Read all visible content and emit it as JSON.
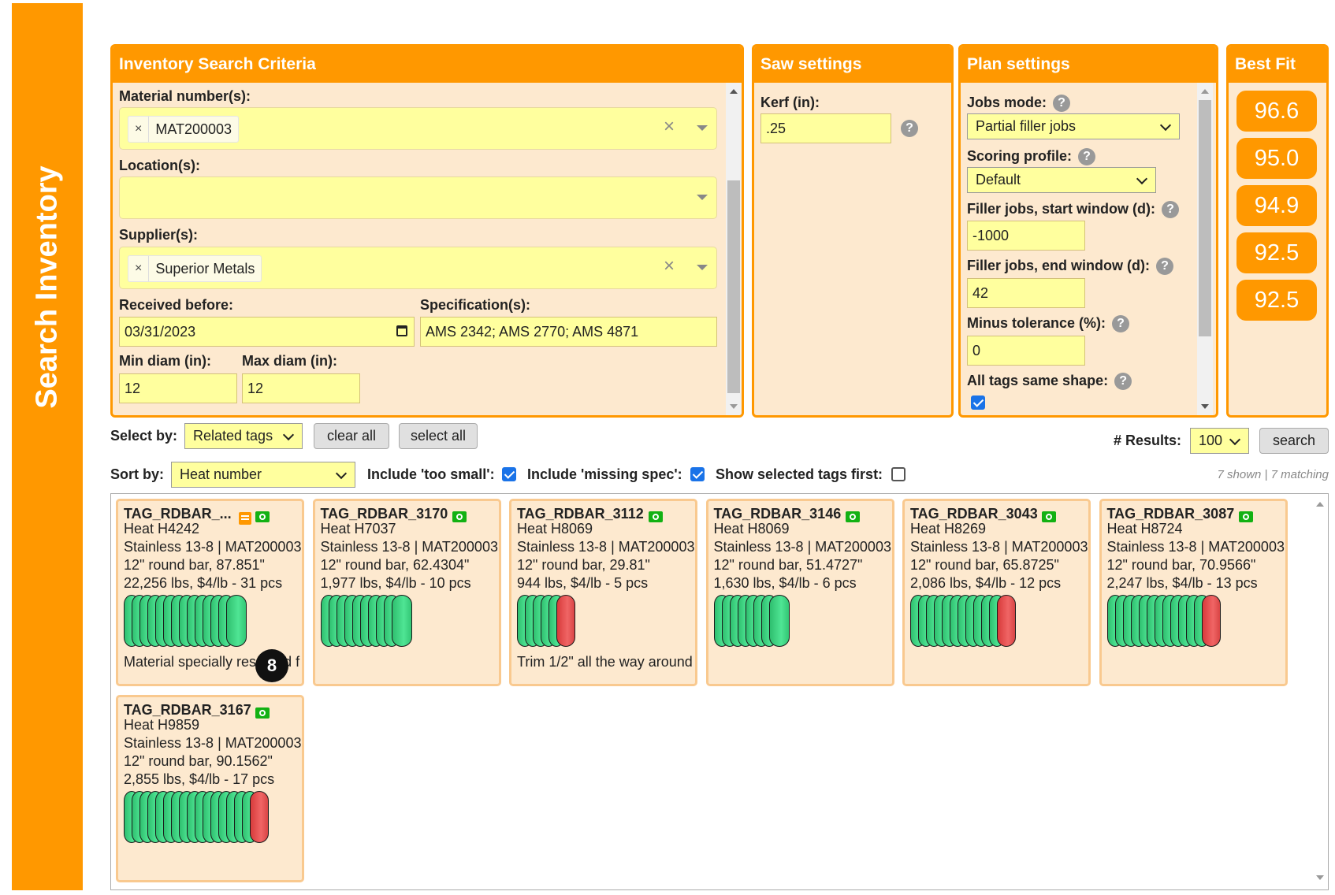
{
  "sidebar": {
    "title": "Search Inventory"
  },
  "search_criteria": {
    "title": "Inventory Search Criteria",
    "material_label": "Material number(s):",
    "material_chip": "MAT200003",
    "location_label": "Location(s):",
    "supplier_label": "Supplier(s):",
    "supplier_chip": "Superior Metals",
    "received_label": "Received before:",
    "received_value": "03/31/2023",
    "spec_label": "Specification(s):",
    "spec_value": "AMS 2342; AMS 2770; AMS 4871",
    "min_label": "Min diam (in):",
    "min_value": "12",
    "max_label": "Max diam (in):",
    "max_value": "12"
  },
  "saw": {
    "title": "Saw settings",
    "kerf_label": "Kerf (in):",
    "kerf_value": ".25"
  },
  "plan": {
    "title": "Plan settings",
    "jobs_mode_label": "Jobs mode:",
    "jobs_mode_value": "Partial filler jobs",
    "scoring_label": "Scoring profile:",
    "scoring_value": "Default",
    "start_label": "Filler jobs, start window (d):",
    "start_value": "-1000",
    "end_label": "Filler jobs, end window (d):",
    "end_value": "42",
    "minus_label": "Minus tolerance (%):",
    "minus_value": "0",
    "same_shape_label": "All tags same shape:",
    "same_shape_checked": true
  },
  "best_fit": {
    "title": "Best Fit",
    "scores": [
      "96.6",
      "95.0",
      "94.9",
      "92.5",
      "92.5"
    ]
  },
  "controls": {
    "select_by_label": "Select by:",
    "select_by_value": "Related tags",
    "clear_all": "clear all",
    "select_all": "select all",
    "results_label": "# Results:",
    "results_value": "100",
    "search": "search",
    "sort_by_label": "Sort by:",
    "sort_by_value": "Heat number",
    "too_small_label": "Include 'too small':",
    "missing_spec_label": "Include 'missing spec':",
    "show_selected_label": "Show selected tags first:",
    "shown_text": "7 shown | 7 matching"
  },
  "help_glyph": "?",
  "tags": [
    {
      "id": "TAG_RDBAR_...",
      "heat": "Heat H4242",
      "material": "Stainless 13-8 | MAT200003",
      "shape": "12\" round bar, 87.851\"",
      "stock": "22,256 lbs, $4/lb - 31 pcs",
      "note": "Material specially reserved f",
      "green": 14,
      "red": 0,
      "badge": "8",
      "has_note": true
    },
    {
      "id": "TAG_RDBAR_3170",
      "heat": "Heat H7037",
      "material": "Stainless 13-8 | MAT200003",
      "shape": "12\" round bar, 62.4304\"",
      "stock": "1,977 lbs, $4/lb - 10 pcs",
      "note": "",
      "green": 10,
      "red": 0
    },
    {
      "id": "TAG_RDBAR_3112",
      "heat": "Heat H8069",
      "material": "Stainless 13-8 | MAT200003",
      "shape": "12\" round bar, 29.81\"",
      "stock": "944 lbs, $4/lb - 5 pcs",
      "note": "Trim 1/2\" all the way around",
      "green": 5,
      "red": 1
    },
    {
      "id": "TAG_RDBAR_3146",
      "heat": "Heat H8069",
      "material": "Stainless 13-8 | MAT200003",
      "shape": "12\" round bar, 51.4727\"",
      "stock": "1,630 lbs, $4/lb - 6 pcs",
      "note": "",
      "green": 8,
      "red": 0
    },
    {
      "id": "TAG_RDBAR_3043",
      "heat": "Heat H8269",
      "material": "Stainless 13-8 | MAT200003",
      "shape": "12\" round bar, 65.8725\"",
      "stock": "2,086 lbs, $4/lb - 12 pcs",
      "note": "",
      "green": 11,
      "red": 1
    },
    {
      "id": "TAG_RDBAR_3087",
      "heat": "Heat H8724",
      "material": "Stainless 13-8 | MAT200003",
      "shape": "12\" round bar, 70.9566\"",
      "stock": "2,247 lbs, $4/lb - 13 pcs",
      "note": "",
      "green": 12,
      "red": 1
    },
    {
      "id": "TAG_RDBAR_3167",
      "heat": "Heat H9859",
      "material": "Stainless 13-8 | MAT200003",
      "shape": "12\" round bar, 90.1562\"",
      "stock": "2,855 lbs, $4/lb - 17 pcs",
      "note": "",
      "green": 16,
      "red": 1
    }
  ]
}
